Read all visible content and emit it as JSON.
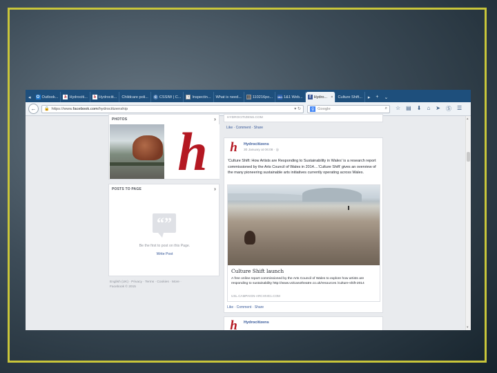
{
  "browser": {
    "tabs": [
      {
        "label": "Outlook...",
        "icon": "outlook-icon"
      },
      {
        "label": "Hydrociti...",
        "icon": "h-logo-icon"
      },
      {
        "label": "Hydrociti...",
        "icon": "h-logo-icon"
      },
      {
        "label": "Childcare poli...",
        "icon": "page-icon"
      },
      {
        "label": "CSSIW | C...",
        "icon": "cssiw-icon"
      },
      {
        "label": "Inspectin...",
        "icon": "page-icon"
      },
      {
        "label": "What is need...",
        "icon": "page-icon"
      },
      {
        "label": "110216po...",
        "icon": "document-icon"
      },
      {
        "label": "1&1 Web...",
        "icon": "webmail-icon"
      },
      {
        "label": "Hydro...",
        "icon": "facebook-icon",
        "active": true
      },
      {
        "label": "Culture Shift...",
        "icon": "page-icon"
      }
    ],
    "url_prefix": "https://www.",
    "url_domain": "facebook.com",
    "url_path": "/hydrocitizenship",
    "search_placeholder": "Google"
  },
  "left": {
    "photos_title": "PHOTOS",
    "posts_title": "POSTS TO PAGE",
    "empty_text": "Be the first to post on this Page.",
    "write_post": "Write Post",
    "footer_line1": "English (UK) · Privacy · Terms · Cookies · More ·",
    "footer_line2": "Facebook © 2015"
  },
  "right": {
    "prev_link": "HYDROCITIZENS.COM",
    "actions": "Like · Comment · Share",
    "post": {
      "author": "Hydrocitizens",
      "date": "30 January at 06:08 · ",
      "text": "'Culture Shift: How Artists are Responding to Sustainability in Wales' is a research report commissioned by the Arts Council of Wales in 2014....'Culture Shift' gives an overview of the many pioneering sustainable arts initiatives currently operating across Wales.",
      "link_title": "Culture Shift launch",
      "link_desc": "A free online report commissioned by the Arts Council of Wales to explore how artists are responding to sustainability http://www.volcanotheatre.co.uk/resources /culture-shift-2014",
      "link_domain": "USL.CAMPAIGN-ARCHIVE1.COM"
    },
    "post2_author": "Hydrocitizens"
  },
  "colors": {
    "frame": "#c9c63a",
    "fb_link": "#365899",
    "logo_red": "#b41822",
    "tab_bar": "#1e4f7c"
  }
}
